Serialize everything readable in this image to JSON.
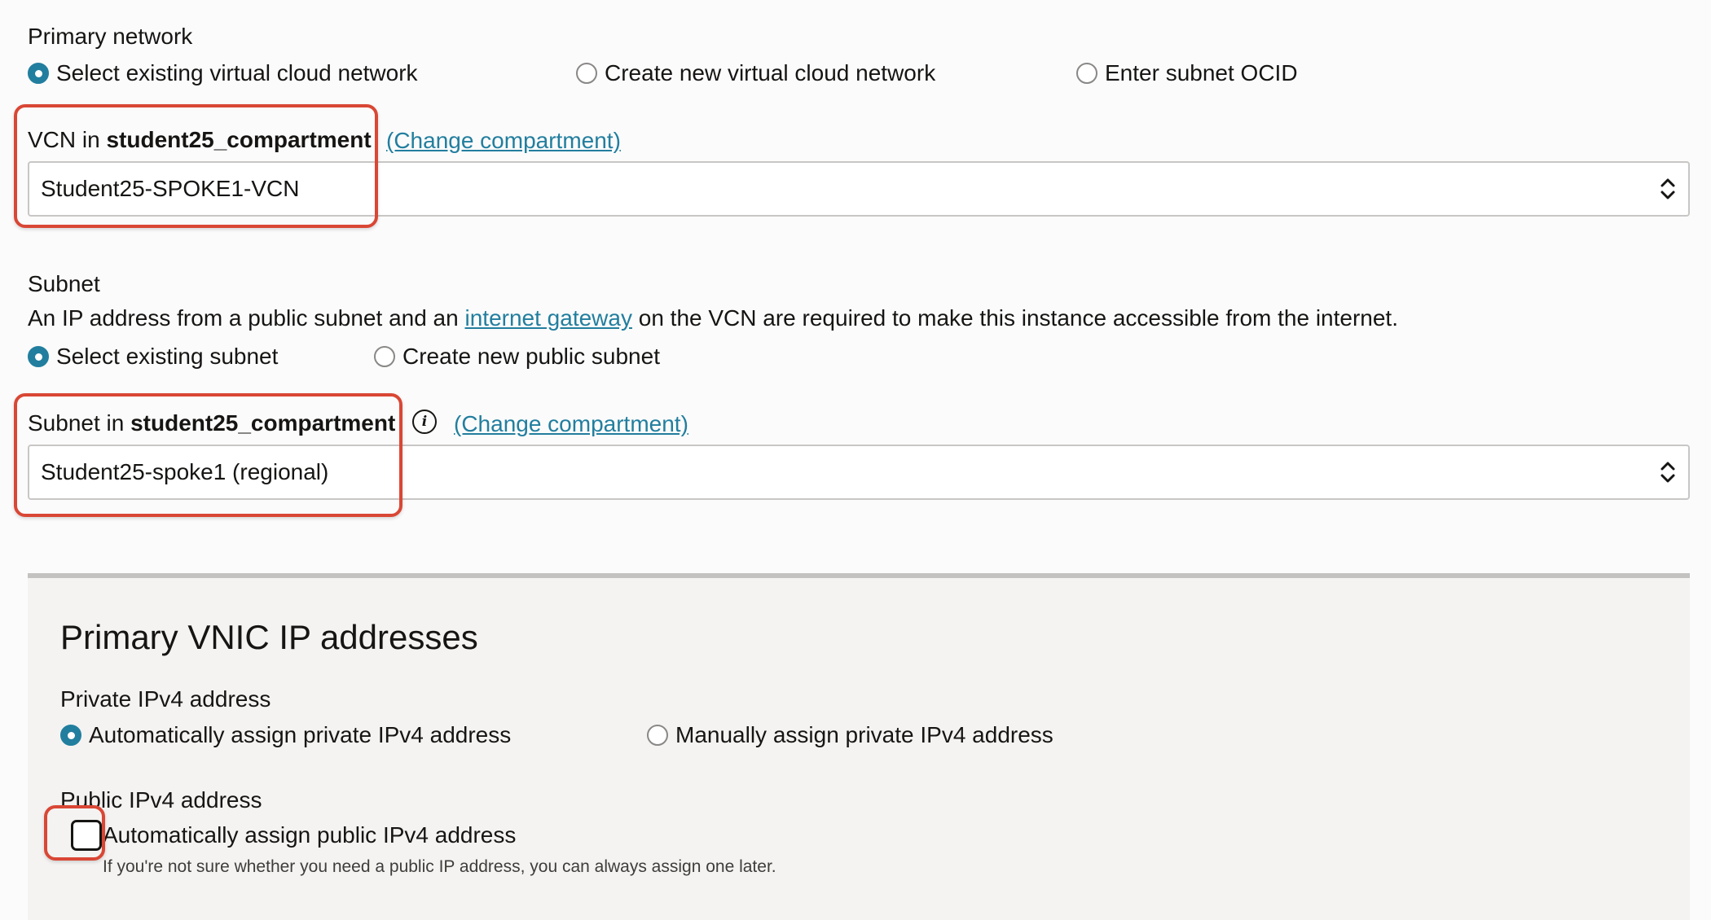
{
  "primary_network": {
    "heading": "Primary network",
    "options": [
      {
        "label": "Select existing virtual cloud network",
        "selected": true
      },
      {
        "label": "Create new virtual cloud network",
        "selected": false
      },
      {
        "label": "Enter subnet OCID",
        "selected": false
      }
    ],
    "vcn_label_prefix": "VCN in",
    "vcn_compartment": "student25_compartment",
    "change_compartment_link": "(Change compartment)",
    "vcn_value": "Student25-SPOKE1-VCN"
  },
  "subnet": {
    "heading": "Subnet",
    "description_before": "An IP address from a public subnet and an",
    "description_link": "internet gateway",
    "description_after": "on the VCN are required to make this instance accessible from the internet.",
    "options": [
      {
        "label": "Select existing subnet",
        "selected": true
      },
      {
        "label": "Create new public subnet",
        "selected": false
      }
    ],
    "subnet_label_prefix": "Subnet in",
    "subnet_compartment": "student25_compartment",
    "change_compartment_link": "(Change compartment)",
    "subnet_value": "Student25-spoke1 (regional)"
  },
  "vnic": {
    "title": "Primary VNIC IP addresses",
    "private_heading": "Private IPv4 address",
    "private_options": [
      {
        "label": "Automatically assign private IPv4 address",
        "selected": true
      },
      {
        "label": "Manually assign private IPv4 address",
        "selected": false
      }
    ],
    "public_heading": "Public IPv4 address",
    "public_checkbox_label": "Automatically assign public IPv4 address",
    "public_checkbox_checked": false,
    "public_help": "If you're not sure whether you need a public IP address, you can always assign one later."
  },
  "colors": {
    "accent": "#227e9e",
    "highlight": "#d94735"
  }
}
